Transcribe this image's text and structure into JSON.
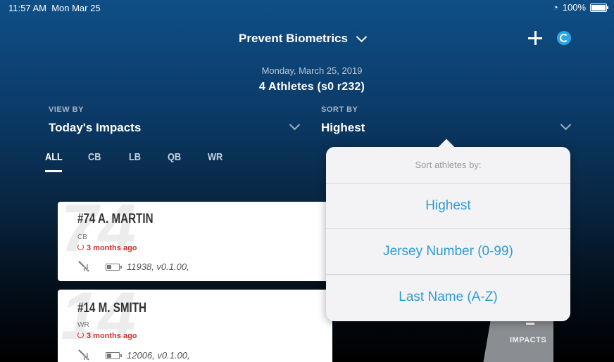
{
  "status": {
    "time": "11:57 AM",
    "date": "Mon Mar 25",
    "wifi": "wifi-icon",
    "battery_text": "100%"
  },
  "nav": {
    "title": "Prevent Biometrics"
  },
  "header": {
    "date": "Monday, March 25, 2019",
    "athlete_count": "4 Athletes (s0 r232)"
  },
  "filters": {
    "view_by": {
      "label": "VIEW BY",
      "value": "Today's Impacts"
    },
    "sort_by": {
      "label": "SORT BY",
      "value": "Highest"
    }
  },
  "tabs": [
    {
      "label": "ALL",
      "active": true
    },
    {
      "label": "CB"
    },
    {
      "label": "LB"
    },
    {
      "label": "QB"
    },
    {
      "label": "WR"
    }
  ],
  "athletes": [
    {
      "watermark": "74",
      "name": "#74  A. MARTIN",
      "position": "CB",
      "last_sync": "3 months ago",
      "device_info": "11938, v0.1.00,"
    },
    {
      "watermark": "14",
      "name": "#14  M. SMITH",
      "position": "WR",
      "last_sync": "3 months ago",
      "device_info": "12006, v0.1.00,"
    }
  ],
  "impacts_badge": {
    "label": "IMPACTS"
  },
  "sort_popover": {
    "header": "Sort athletes by:",
    "options": [
      "Highest",
      "Jersey Number (0-99)",
      "Last Name (A-Z)"
    ]
  },
  "colors": {
    "accent": "#2f9ad6",
    "alert": "#d0312d",
    "nav_bg_top": "#0f4f86"
  }
}
